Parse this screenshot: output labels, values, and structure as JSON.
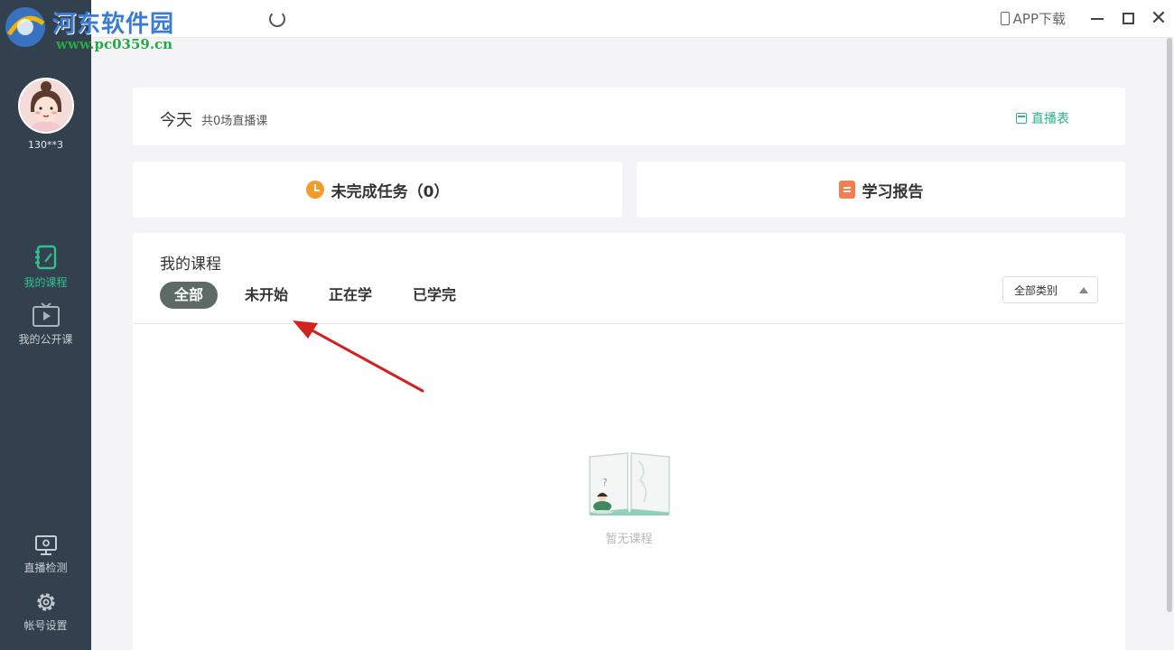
{
  "titlebar": {
    "watermark_title": "河东软件园",
    "watermark_url": "www.pc0359.cn",
    "app_download": "APP下载"
  },
  "sidebar": {
    "username": "130**3",
    "items": [
      {
        "label": "我的课程",
        "icon": "notebook-icon",
        "active": true
      },
      {
        "label": "我的公开课",
        "icon": "tv-play-icon",
        "active": false
      },
      {
        "label": "直播检测",
        "icon": "monitor-icon",
        "active": false
      },
      {
        "label": "帐号设置",
        "icon": "gear-icon",
        "active": false
      }
    ]
  },
  "today": {
    "title": "今天",
    "subtitle": "共0场直播课",
    "schedule_link": "直播表"
  },
  "tasks": {
    "incomplete_label": "未完成任务（0）",
    "report_label": "学习报告"
  },
  "courses": {
    "title": "我的课程",
    "tabs": [
      {
        "label": "全部",
        "active": true
      },
      {
        "label": "未开始",
        "active": false
      },
      {
        "label": "正在学",
        "active": false
      },
      {
        "label": "已学完",
        "active": false
      }
    ],
    "category_select": "全部类别",
    "empty_text": "暂无课程"
  },
  "colors": {
    "sidebar_bg": "#33404e",
    "accent_green": "#2fc18e",
    "tab_active_bg": "#5e6a66",
    "clock_orange": "#f39c2a",
    "report_orange": "#f47e4f"
  }
}
